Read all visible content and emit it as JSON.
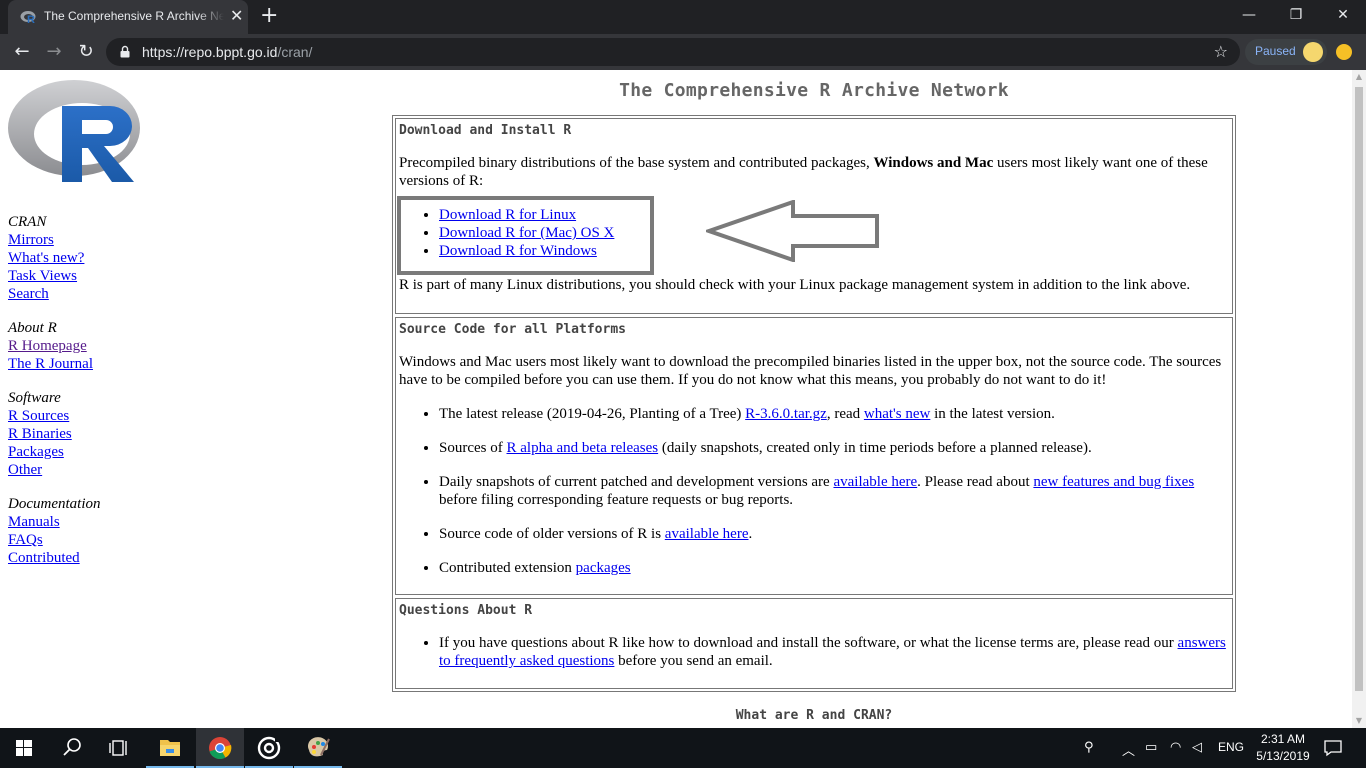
{
  "browser": {
    "tab_title": "The Comprehensive R Archive Network",
    "tab_close": "✕",
    "new_tab": "+",
    "url_host": "https://repo.bppt.go.id",
    "url_path": "/cran/",
    "profile_status": "Paused",
    "window_controls": {
      "minimize": "—",
      "restore": "❐",
      "close": "✕"
    },
    "nav": {
      "back": "←",
      "forward": "→",
      "reload": "↻"
    },
    "star": "☆"
  },
  "page": {
    "title": "The Comprehensive R Archive Network",
    "sidebar": {
      "groups": [
        {
          "heading": "CRAN",
          "links": [
            "Mirrors",
            "What's new?",
            "Task Views",
            "Search"
          ]
        },
        {
          "heading": "About R",
          "links": [
            "R Homepage",
            "The R Journal"
          ]
        },
        {
          "heading": "Software",
          "links": [
            "R Sources",
            "R Binaries",
            "Packages",
            "Other"
          ]
        },
        {
          "heading": "Documentation",
          "links": [
            "Manuals",
            "FAQs",
            "Contributed"
          ]
        }
      ]
    },
    "download": {
      "heading": "Download and Install R",
      "intro_before": "Precompiled binary distributions of the base system and contributed packages, ",
      "intro_bold": "Windows and Mac",
      "intro_after": " users most likely want one of these versions of R:",
      "links": [
        "Download R for Linux",
        "Download R for (Mac) OS X",
        "Download R for Windows"
      ],
      "note": "R is part of many Linux distributions, you should check with your Linux package management system in addition to the link above."
    },
    "source": {
      "heading": "Source Code for all Platforms",
      "intro": "Windows and Mac users most likely want to download the precompiled binaries listed in the upper box, not the source code. The sources have to be compiled before you can use them. If you do not know what this means, you probably do not want to do it!",
      "item1_a": "The latest release (2019-04-26, Planting of a Tree) ",
      "item1_link1": "R-3.6.0.tar.gz",
      "item1_b": ", read ",
      "item1_link2": "what's new",
      "item1_c": " in the latest version.",
      "item2_a": "Sources of ",
      "item2_link": "R alpha and beta releases",
      "item2_b": " (daily snapshots, created only in time periods before a planned release).",
      "item3_a": "Daily snapshots of current patched and development versions are ",
      "item3_link1": "available here",
      "item3_b": ". Please read about ",
      "item3_link2": "new features and bug fixes",
      "item3_c": " before filing corresponding feature requests or bug reports.",
      "item4_a": "Source code of older versions of R is ",
      "item4_link": "available here",
      "item4_b": ".",
      "item5_a": "Contributed extension ",
      "item5_link": "packages"
    },
    "questions": {
      "heading": "Questions About R",
      "item_a": "If you have questions about R like how to download and install the software, or what the license terms are, please read our ",
      "item_link": "answers to frequently asked questions",
      "item_b": " before you send an email."
    },
    "next_section_title": "What are R and CRAN?"
  },
  "taskbar": {
    "language": "ENG",
    "time": "2:31 AM",
    "date": "5/13/2019"
  },
  "colors": {
    "link": "#0000ee",
    "visited": "#551a8b",
    "taskbar": "#101418"
  }
}
